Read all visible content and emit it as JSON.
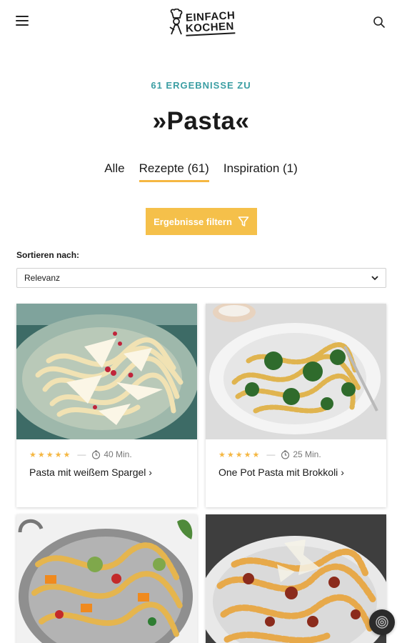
{
  "header": {
    "logo_line1": "EINFACH",
    "logo_line2": "KOCHEN",
    "menu_icon": "hamburger-menu-icon",
    "search_icon": "search-icon"
  },
  "results": {
    "kicker": "61 ERGEBNISSE ZU",
    "query_title": "»Pasta«"
  },
  "tabs": [
    {
      "label": "Alle",
      "active": false
    },
    {
      "label": "Rezepte (61)",
      "active": true
    },
    {
      "label": "Inspiration (1)",
      "active": false
    }
  ],
  "filter": {
    "label": "Ergebnisse filtern",
    "icon": "funnel-icon"
  },
  "sort": {
    "label": "Sortieren nach:",
    "selected": "Relevanz"
  },
  "cards": [
    {
      "title": "Pasta mit weißem Spargel",
      "time": "40 Min.",
      "rating": 5,
      "arrow": "›"
    },
    {
      "title": "One Pot Pasta mit Brokkoli",
      "time": "25 Min.",
      "rating": 5,
      "arrow": "›"
    },
    {
      "title": "",
      "time": "",
      "rating": 0
    },
    {
      "title": "",
      "time": "",
      "rating": 0
    }
  ],
  "colors": {
    "accent_teal": "#3b9ea3",
    "accent_yellow": "#f5c04a",
    "underline": "#f5b742"
  }
}
